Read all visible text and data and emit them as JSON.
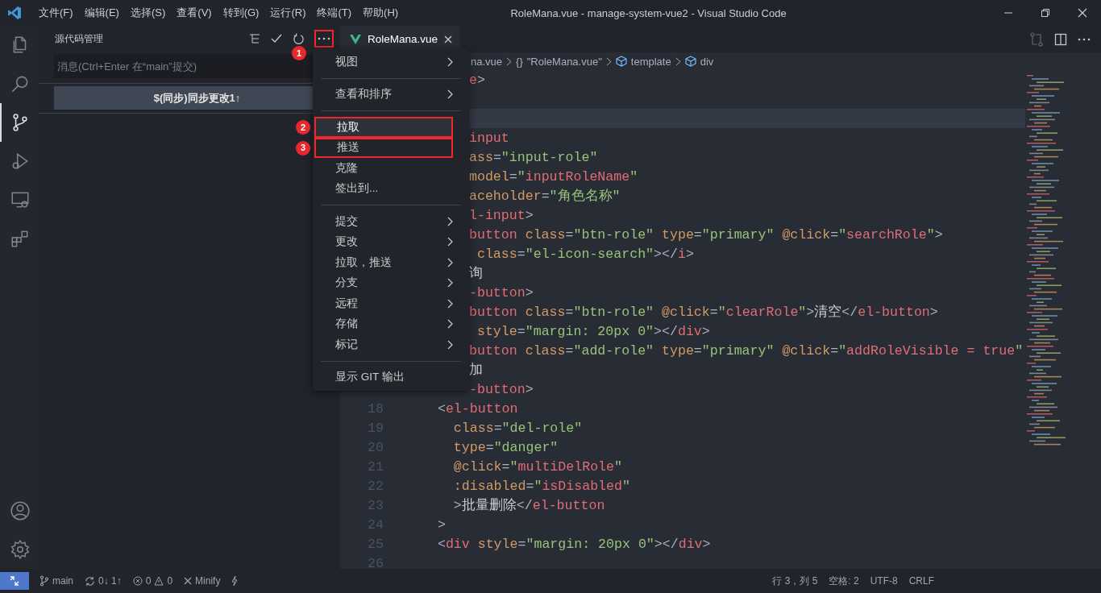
{
  "window": {
    "title": "RoleMana.vue - manage-system-vue2 - Visual Studio Code"
  },
  "menu_bar": [
    "文件(F)",
    "编辑(E)",
    "选择(S)",
    "查看(V)",
    "转到(G)",
    "运行(R)",
    "终端(T)",
    "帮助(H)"
  ],
  "activity_bar": {
    "items": [
      {
        "selected": false
      },
      {
        "selected": false
      },
      {
        "selected": true
      },
      {
        "selected": false
      },
      {
        "selected": false
      },
      {
        "selected": false
      }
    ]
  },
  "sidebar": {
    "title": "源代码管理",
    "more_button": {
      "marked": true,
      "callout": "1"
    },
    "message_input": {
      "placeholder": "消息(Ctrl+Enter 在“main”提交)"
    },
    "sync_button": "$(同步)同步更改1↑"
  },
  "editor": {
    "tabs": [
      {
        "label": "RoleMana.vue",
        "selected": true
      }
    ],
    "breadcrumb": [
      {
        "kind": "file",
        "text": "na.vue"
      },
      {
        "kind": "object",
        "glyph": "{}",
        "text": "\"RoleMana.vue\""
      },
      {
        "kind": "element",
        "text": "template"
      },
      {
        "kind": "element",
        "text": "div"
      }
    ],
    "lines": [
      {
        "kind": "clipped",
        "current": false,
        "parts": [
          {
            "kind": "tag",
            "text": "e"
          },
          {
            "kind": "punct",
            "text": ">"
          }
        ]
      },
      {
        "kind": "clipped",
        "current": false
      },
      {
        "kind": "clipped",
        "current": true
      },
      {
        "kind": "clipped",
        "current": false,
        "parts": [
          {
            "kind": "tag",
            "text": "input"
          }
        ]
      },
      {
        "kind": "clipped",
        "current": false,
        "parts": [
          {
            "kind": "attr",
            "text": "ass"
          },
          {
            "kind": "punct",
            "text": "="
          },
          {
            "kind": "str",
            "text": "\"input-role\""
          }
        ]
      },
      {
        "kind": "clipped",
        "current": false,
        "parts": [
          {
            "kind": "attr",
            "text": "model"
          },
          {
            "kind": "punct",
            "text": "="
          },
          {
            "kind": "str",
            "text": "\""
          },
          {
            "kind": "expr",
            "text": "inputRoleName"
          },
          {
            "kind": "str",
            "text": "\""
          }
        ]
      },
      {
        "kind": "clipped",
        "current": false,
        "parts": [
          {
            "kind": "attr",
            "text": "aceholder"
          },
          {
            "kind": "punct",
            "text": "="
          },
          {
            "kind": "str",
            "text": "\"角色名称\""
          }
        ]
      },
      {
        "kind": "clipped",
        "current": false,
        "parts": [
          {
            "kind": "tag",
            "text": "l-input"
          },
          {
            "kind": "punct",
            "text": ">"
          }
        ]
      },
      {
        "kind": "clipped",
        "current": false,
        "parts": [
          {
            "kind": "tag",
            "text": "button"
          },
          {
            "kind": "attr",
            "text": " class"
          },
          {
            "kind": "punct",
            "text": "="
          },
          {
            "kind": "str",
            "text": "\"btn-role\""
          },
          {
            "kind": "attr",
            "text": " type"
          },
          {
            "kind": "punct",
            "text": "="
          },
          {
            "kind": "str",
            "text": "\"primary\""
          },
          {
            "kind": "attr",
            "text": " @click"
          },
          {
            "kind": "punct",
            "text": "="
          },
          {
            "kind": "str",
            "text": "\""
          },
          {
            "kind": "expr",
            "text": "searchRole"
          },
          {
            "kind": "str",
            "text": "\""
          },
          {
            "kind": "punct",
            "text": ">"
          }
        ]
      },
      {
        "kind": "clipped",
        "current": false,
        "parts": [
          {
            "kind": "attr",
            "text": " class"
          },
          {
            "kind": "punct",
            "text": "="
          },
          {
            "kind": "str",
            "text": "\"el-icon-search\""
          },
          {
            "kind": "punct",
            "text": "></"
          },
          {
            "kind": "tag",
            "text": "i"
          },
          {
            "kind": "punct",
            "text": ">"
          }
        ]
      },
      {
        "kind": "clipped",
        "current": false,
        "parts": [
          {
            "kind": "plain",
            "text": "询"
          }
        ]
      },
      {
        "kind": "clipped",
        "current": false,
        "parts": [
          {
            "kind": "tag",
            "text": "-button"
          },
          {
            "kind": "punct",
            "text": ">"
          }
        ]
      },
      {
        "kind": "clipped",
        "current": false,
        "parts": [
          {
            "kind": "tag",
            "text": "button"
          },
          {
            "kind": "attr",
            "text": " class"
          },
          {
            "kind": "punct",
            "text": "="
          },
          {
            "kind": "str",
            "text": "\"btn-role\""
          },
          {
            "kind": "attr",
            "text": " @click"
          },
          {
            "kind": "punct",
            "text": "="
          },
          {
            "kind": "str",
            "text": "\""
          },
          {
            "kind": "expr",
            "text": "clearRole"
          },
          {
            "kind": "str",
            "text": "\""
          },
          {
            "kind": "punct",
            "text": ">"
          },
          {
            "kind": "plain",
            "text": "清空"
          },
          {
            "kind": "punct",
            "text": "</"
          },
          {
            "kind": "tag",
            "text": "el-button"
          },
          {
            "kind": "punct",
            "text": ">"
          }
        ]
      },
      {
        "kind": "clipped",
        "current": false,
        "parts": [
          {
            "kind": "attr",
            "text": " style"
          },
          {
            "kind": "punct",
            "text": "="
          },
          {
            "kind": "str",
            "text": "\"margin: 20px 0\""
          },
          {
            "kind": "punct",
            "text": "></"
          },
          {
            "kind": "tag",
            "text": "div"
          },
          {
            "kind": "punct",
            "text": ">"
          }
        ]
      },
      {
        "kind": "clipped",
        "current": false,
        "parts": [
          {
            "kind": "tag",
            "text": "button"
          },
          {
            "kind": "attr",
            "text": " class"
          },
          {
            "kind": "punct",
            "text": "="
          },
          {
            "kind": "str",
            "text": "\"add-role\""
          },
          {
            "kind": "attr",
            "text": " type"
          },
          {
            "kind": "punct",
            "text": "="
          },
          {
            "kind": "str",
            "text": "\"primary\""
          },
          {
            "kind": "attr",
            "text": " @click"
          },
          {
            "kind": "punct",
            "text": "="
          },
          {
            "kind": "str",
            "text": "\""
          },
          {
            "kind": "expr",
            "text": "addRoleVisible = true"
          },
          {
            "kind": "str",
            "text": "\""
          }
        ]
      },
      {
        "kind": "clipped",
        "current": false,
        "parts": [
          {
            "kind": "plain",
            "text": "加"
          }
        ]
      },
      {
        "kind": "clipped",
        "current": false,
        "parts": [
          {
            "kind": "tag",
            "text": "-button"
          },
          {
            "kind": "punct",
            "text": ">"
          }
        ]
      },
      {
        "kind": "numbered",
        "number": "18",
        "current": false,
        "parts": [
          {
            "kind": "punct",
            "text": "  <"
          },
          {
            "kind": "tag",
            "text": "el-button"
          }
        ]
      },
      {
        "kind": "numbered",
        "number": "19",
        "current": false,
        "parts": [
          {
            "kind": "attr",
            "text": "    class"
          },
          {
            "kind": "punct",
            "text": "="
          },
          {
            "kind": "str",
            "text": "\"del-role\""
          }
        ]
      },
      {
        "kind": "numbered",
        "number": "20",
        "current": false,
        "parts": [
          {
            "kind": "attr",
            "text": "    type"
          },
          {
            "kind": "punct",
            "text": "="
          },
          {
            "kind": "str",
            "text": "\"danger\""
          }
        ]
      },
      {
        "kind": "numbered",
        "number": "21",
        "current": false,
        "parts": [
          {
            "kind": "attr",
            "text": "    @click"
          },
          {
            "kind": "punct",
            "text": "="
          },
          {
            "kind": "str",
            "text": "\""
          },
          {
            "kind": "expr",
            "text": "multiDelRole"
          },
          {
            "kind": "str",
            "text": "\""
          }
        ]
      },
      {
        "kind": "numbered",
        "number": "22",
        "current": false,
        "parts": [
          {
            "kind": "attr",
            "text": "    :disabled"
          },
          {
            "kind": "punct",
            "text": "="
          },
          {
            "kind": "str",
            "text": "\""
          },
          {
            "kind": "expr",
            "text": "isDisabled"
          },
          {
            "kind": "str",
            "text": "\""
          }
        ]
      },
      {
        "kind": "numbered",
        "number": "23",
        "current": false,
        "parts": [
          {
            "kind": "punct",
            "text": "    >"
          },
          {
            "kind": "plain",
            "text": "批量删除"
          },
          {
            "kind": "punct",
            "text": "</"
          },
          {
            "kind": "tag",
            "text": "el-button"
          }
        ]
      },
      {
        "kind": "numbered",
        "number": "24",
        "current": false,
        "parts": [
          {
            "kind": "punct",
            "text": "  >"
          }
        ]
      },
      {
        "kind": "numbered",
        "number": "25",
        "current": false,
        "parts": [
          {
            "kind": "punct",
            "text": "  <"
          },
          {
            "kind": "tag",
            "text": "div"
          },
          {
            "kind": "attr",
            "text": " style"
          },
          {
            "kind": "punct",
            "text": "="
          },
          {
            "kind": "str",
            "text": "\"margin: 20px 0\""
          },
          {
            "kind": "punct",
            "text": "></"
          },
          {
            "kind": "tag",
            "text": "div"
          },
          {
            "kind": "punct",
            "text": ">"
          }
        ]
      },
      {
        "kind": "numbered",
        "number": "26",
        "current": false
      }
    ]
  },
  "context_menu": [
    {
      "kind": "item",
      "label": "视图",
      "submenu": true,
      "highlighted": false,
      "marked": false
    },
    {
      "kind": "separator"
    },
    {
      "kind": "item",
      "label": "查看和排序",
      "submenu": true,
      "highlighted": false,
      "marked": false
    },
    {
      "kind": "separator"
    },
    {
      "kind": "item",
      "label": "拉取",
      "submenu": false,
      "highlighted": true,
      "marked": true,
      "callout": "2"
    },
    {
      "kind": "item",
      "label": "推送",
      "submenu": false,
      "highlighted": false,
      "marked": true,
      "callout": "3"
    },
    {
      "kind": "item",
      "label": "克隆",
      "submenu": false,
      "highlighted": false,
      "marked": false
    },
    {
      "kind": "item",
      "label": "签出到...",
      "submenu": false,
      "highlighted": false,
      "marked": false
    },
    {
      "kind": "separator"
    },
    {
      "kind": "item",
      "label": "提交",
      "submenu": true,
      "highlighted": false,
      "marked": false
    },
    {
      "kind": "item",
      "label": "更改",
      "submenu": true,
      "highlighted": false,
      "marked": false
    },
    {
      "kind": "item",
      "label": "拉取，推送",
      "submenu": true,
      "highlighted": false,
      "marked": false
    },
    {
      "kind": "item",
      "label": "分支",
      "submenu": true,
      "highlighted": false,
      "marked": false
    },
    {
      "kind": "item",
      "label": "远程",
      "submenu": true,
      "highlighted": false,
      "marked": false
    },
    {
      "kind": "item",
      "label": "存储",
      "submenu": true,
      "highlighted": false,
      "marked": false
    },
    {
      "kind": "item",
      "label": "标记",
      "submenu": true,
      "highlighted": false,
      "marked": false
    },
    {
      "kind": "separator"
    },
    {
      "kind": "item",
      "label": "显示 GIT 输出",
      "submenu": false,
      "highlighted": false,
      "marked": false
    }
  ],
  "status_bar": {
    "left": [
      {
        "kind": "branch",
        "text": "main"
      },
      {
        "kind": "sync",
        "text": "0↓ 1↑"
      },
      {
        "kind": "problems",
        "errors": "0",
        "warnings": "0"
      },
      {
        "kind": "minify",
        "text": "Minify"
      }
    ],
    "right": [
      "行 3，列 5",
      "空格: 2",
      "UTF-8",
      "CRLF"
    ]
  }
}
